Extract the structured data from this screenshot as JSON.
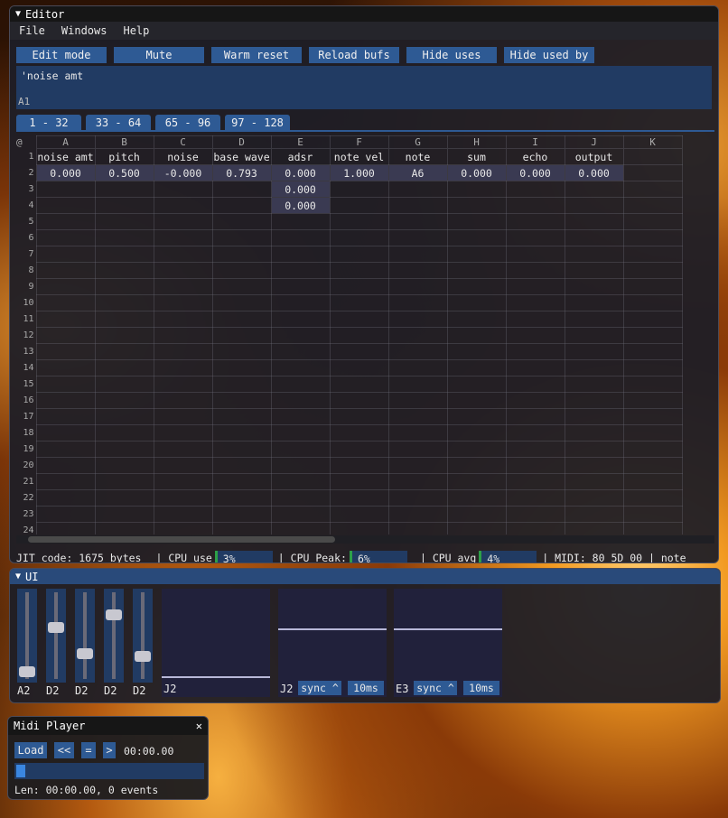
{
  "editor": {
    "title": "Editor",
    "menu": [
      "File",
      "Windows",
      "Help"
    ],
    "buttons": [
      "Edit mode",
      "Mute",
      "Warm reset",
      "Reload bufs",
      "Hide uses",
      "Hide used by"
    ],
    "formula": "'noise amt",
    "cell_ref": "A1",
    "tabs": [
      "1 -  32",
      "33 -  64",
      "65 -  96",
      "97 - 128"
    ],
    "corner": "@",
    "columns": [
      "A",
      "B",
      "C",
      "D",
      "E",
      "F",
      "G",
      "H",
      "I",
      "J",
      "K"
    ],
    "row1": [
      "noise amt",
      "pitch",
      "noise",
      "base wave",
      "adsr",
      "note vel",
      "note",
      "sum",
      "echo",
      "output",
      ""
    ],
    "row2": [
      "0.000",
      "0.500",
      "-0.000",
      "0.793",
      "0.000",
      "1.000",
      "A6",
      "0.000",
      "0.000",
      "0.000",
      ""
    ],
    "e3": "0.000",
    "e4": "0.000",
    "row_numbers": [
      "1",
      "2",
      "3",
      "4",
      "5",
      "6",
      "7",
      "8",
      "9",
      "10",
      "11",
      "12",
      "13",
      "14",
      "15",
      "16",
      "17",
      "18",
      "19",
      "20",
      "21",
      "22",
      "23",
      "24"
    ],
    "status": {
      "jit": "JIT code: 1675 bytes",
      "cpu_use_label": "| CPU use",
      "cpu_use": "3%",
      "cpu_peak_label": "| CPU Peak:",
      "cpu_peak": "6%",
      "cpu_avg_label": "| CPU avg",
      "cpu_avg": "4%",
      "midi": "| MIDI: 80 5D 00 | note"
    }
  },
  "ui": {
    "title": "UI",
    "sliders": [
      {
        "label": "A2",
        "level": 0.05
      },
      {
        "label": "D2",
        "level": 0.62
      },
      {
        "label": "D2",
        "level": 0.28
      },
      {
        "label": "D2",
        "level": 0.78
      },
      {
        "label": "D2",
        "level": 0.25
      }
    ],
    "scopes": [
      {
        "label": "J2",
        "level": 0.12
      },
      {
        "label": "J2",
        "level": 0.6,
        "sync": "sync ^",
        "rate": "10ms"
      },
      {
        "label": "E3",
        "level": 0.6,
        "sync": "sync ^",
        "rate": "10ms"
      }
    ]
  },
  "midi_player": {
    "title": "Midi Player",
    "close": "✕",
    "load": "Load",
    "rewind": "<<",
    "stop": "=",
    "play": ">",
    "time": "00:00.00",
    "progress": 0.0,
    "info": "Len: 00:00.00, 0 events"
  }
}
